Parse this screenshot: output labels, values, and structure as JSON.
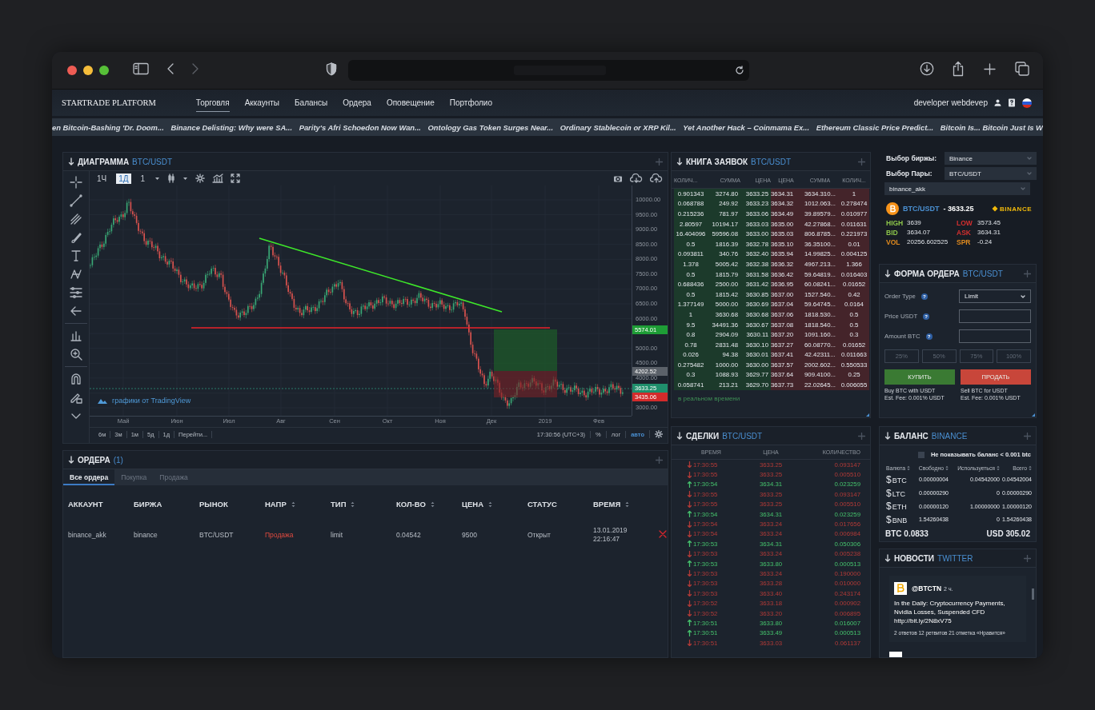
{
  "nav": {
    "brand": "STARTRADE PLATFORM",
    "items": [
      {
        "label": "Торговля",
        "selected": true
      },
      {
        "label": "Аккаунты",
        "selected": false
      },
      {
        "label": "Балансы",
        "selected": false
      },
      {
        "label": "Ордера",
        "selected": false
      },
      {
        "label": "Оповещение",
        "selected": false
      },
      {
        "label": "Портфолио",
        "selected": false
      }
    ],
    "user": "developer webdevep"
  },
  "news_ticker": [
    "en Bitcoin-Bashing 'Dr. Doom...",
    "Binance Delisting: Why were SA...",
    "Parity's Afri Schoedon Now Wan...",
    "Ontology Gas Token Surges Near...",
    "Ordinary Stablecoin or XRP Kil...",
    "Yet Another Hack – Coinmama Ex...",
    "Ethereum Classic Price Predict...",
    "Bitcoin Is... Bitcoin Just Is W"
  ],
  "chart": {
    "title": "ДИАГРАММА",
    "pair": "BTC/USDT",
    "intervals": [
      {
        "label": "1Ч",
        "selected": false
      },
      {
        "label": "1Д",
        "selected": true
      },
      {
        "label": "1",
        "selected": false
      }
    ],
    "price_axis": [
      "10000.00",
      "9500.00",
      "9000.00",
      "8500.00",
      "8000.00",
      "7500.00",
      "7000.00",
      "6500.00",
      "6000.00",
      "5000.00",
      "4500.00",
      "4000.00",
      "3000.00"
    ],
    "time_axis": [
      "Май",
      "Июн",
      "Июл",
      "Авг",
      "Сен",
      "Окт",
      "Ноя",
      "Дек",
      "2019",
      "Фев"
    ],
    "price_tags": [
      {
        "label": "5574.01",
        "color": "#1e9d36"
      },
      {
        "label": "4202.52",
        "color": "#5b6169"
      },
      {
        "label": "3633.25",
        "color": "#1f8f6c"
      },
      {
        "label": "3435.06",
        "color": "#d32b2b"
      }
    ],
    "credit": "графики от TradingView",
    "ranges": [
      "6м",
      "3м",
      "1м",
      "5д",
      "1д",
      "Перейти..."
    ],
    "clock": "17:30:56 (UTC+3)",
    "options": [
      {
        "label": "%",
        "selected": false
      },
      {
        "label": "лог",
        "selected": false
      },
      {
        "label": "авто",
        "selected": true
      }
    ]
  },
  "orders": {
    "title": "ОРДЕРА",
    "count": "(1)",
    "tabs": [
      {
        "label": "Все ордера",
        "selected": true
      },
      {
        "label": "Покупка",
        "selected": false
      },
      {
        "label": "Продажа",
        "selected": false
      }
    ],
    "columns": [
      {
        "label": "АККАУНТ",
        "sortable": false
      },
      {
        "label": "БИРЖА",
        "sortable": false
      },
      {
        "label": "РЫНОК",
        "sortable": false
      },
      {
        "label": "НАПР",
        "sortable": true
      },
      {
        "label": "ТИП",
        "sortable": true
      },
      {
        "label": "КОЛ-ВО",
        "sortable": true
      },
      {
        "label": "ЦЕНА",
        "sortable": true
      },
      {
        "label": "СТАТУС",
        "sortable": false
      },
      {
        "label": "ВРЕМЯ",
        "sortable": true
      }
    ],
    "rows": [
      {
        "kind": "sell",
        "cells": [
          "binance_akk",
          "binance",
          "BTC/USDT",
          "Продажа",
          "limit",
          "0.04542",
          "9500",
          "Открыт",
          "13.01.2019 22:16:47"
        ]
      }
    ]
  },
  "order_book": {
    "title": "КНИГА ЗАЯВОК",
    "pair": "BTC/USDT",
    "columns": [
      "КОЛИЧ...",
      "СУММА",
      "ЦЕНА",
      "ЦЕНА",
      "СУММА",
      "КОЛИЧ..."
    ],
    "rows": [
      [
        "0.901343",
        "3274.80",
        "3633.25",
        "3634.31",
        "3634.310...",
        "1"
      ],
      [
        "0.068788",
        "249.92",
        "3633.23",
        "3634.32",
        "1012.063...",
        "0.278474"
      ],
      [
        "0.215236",
        "781.97",
        "3633.06",
        "3634.49",
        "39.89579...",
        "0.010977"
      ],
      [
        "2.80597",
        "10194.17",
        "3633.03",
        "3635.00",
        "42.27868...",
        "0.011631"
      ],
      [
        "16.404096",
        "59596.08",
        "3633.00",
        "3635.03",
        "806.8785...",
        "0.221973"
      ],
      [
        "0.5",
        "1816.39",
        "3632.78",
        "3635.10",
        "36.35100...",
        "0.01"
      ],
      [
        "0.093811",
        "340.76",
        "3632.40",
        "3635.94",
        "14.99825...",
        "0.004125"
      ],
      [
        "1.378",
        "5005.42",
        "3632.38",
        "3636.32",
        "4967.213...",
        "1.366"
      ],
      [
        "0.5",
        "1815.79",
        "3631.58",
        "3636.42",
        "59.64819...",
        "0.016403"
      ],
      [
        "0.688436",
        "2500.00",
        "3631.42",
        "3636.95",
        "60.08241...",
        "0.01652"
      ],
      [
        "0.5",
        "1815.42",
        "3630.85",
        "3637.00",
        "1527.540...",
        "0.42"
      ],
      [
        "1.377149",
        "5000.00",
        "3630.69",
        "3637.04",
        "59.64745...",
        "0.0164"
      ],
      [
        "1",
        "3630.68",
        "3630.68",
        "3637.06",
        "1818.530...",
        "0.5"
      ],
      [
        "9.5",
        "34491.36",
        "3630.67",
        "3637.08",
        "1818.540...",
        "0.5"
      ],
      [
        "0.8",
        "2904.09",
        "3630.11",
        "3637.20",
        "1091.160...",
        "0.3"
      ],
      [
        "0.78",
        "2831.48",
        "3630.10",
        "3637.27",
        "60.08770...",
        "0.01652"
      ],
      [
        "0.026",
        "94.38",
        "3630.01",
        "3637.41",
        "42.42311...",
        "0.011663"
      ],
      [
        "0.275482",
        "1000.00",
        "3630.00",
        "3637.57",
        "2002.602...",
        "0.550533"
      ],
      [
        "0.3",
        "1088.93",
        "3629.77",
        "3637.64",
        "909.4100...",
        "0.25"
      ],
      [
        "0.058741",
        "213.21",
        "3629.70",
        "3637.73",
        "22.02645...",
        "0.006055"
      ]
    ],
    "footer": "в реальном времени"
  },
  "trades": {
    "title": "СДЕЛКИ",
    "pair": "BTC/USDT",
    "columns": [
      "ВРЕМЯ",
      "ЦЕНА",
      "КОЛИЧЕСТВО"
    ],
    "rows": [
      {
        "kind": "sell",
        "time": "17:30:55",
        "price": "3633.25",
        "amount": "0.093147"
      },
      {
        "kind": "sell",
        "time": "17:30:55",
        "price": "3633.25",
        "amount": "0.005510"
      },
      {
        "kind": "buy",
        "time": "17:30:54",
        "price": "3634.31",
        "amount": "0.023259"
      },
      {
        "kind": "sell",
        "time": "17:30:55",
        "price": "3633.25",
        "amount": "0.093147"
      },
      {
        "kind": "sell",
        "time": "17:30:55",
        "price": "3633.25",
        "amount": "0.005510"
      },
      {
        "kind": "buy",
        "time": "17:30:54",
        "price": "3634.31",
        "amount": "0.023259"
      },
      {
        "kind": "sell",
        "time": "17:30:54",
        "price": "3633.24",
        "amount": "0.017656"
      },
      {
        "kind": "sell",
        "time": "17:30:54",
        "price": "3633.24",
        "amount": "0.006984"
      },
      {
        "kind": "buy",
        "time": "17:30:53",
        "price": "3634.31",
        "amount": "0.050306"
      },
      {
        "kind": "sell",
        "time": "17:30:53",
        "price": "3633.24",
        "amount": "0.005238"
      },
      {
        "kind": "buy",
        "time": "17:30:53",
        "price": "3633.80",
        "amount": "0.000513"
      },
      {
        "kind": "sell",
        "time": "17:30:53",
        "price": "3633.24",
        "amount": "0.190000"
      },
      {
        "kind": "sell",
        "time": "17:30:53",
        "price": "3633.28",
        "amount": "0.010000"
      },
      {
        "kind": "sell",
        "time": "17:30:53",
        "price": "3633.40",
        "amount": "0.243174"
      },
      {
        "kind": "sell",
        "time": "17:30:52",
        "price": "3633.18",
        "amount": "0.000902"
      },
      {
        "kind": "sell",
        "time": "17:30:52",
        "price": "3633.20",
        "amount": "0.006895"
      },
      {
        "kind": "buy",
        "time": "17:30:51",
        "price": "3633.80",
        "amount": "0.016007"
      },
      {
        "kind": "buy",
        "time": "17:30:51",
        "price": "3633.49",
        "amount": "0.000513"
      },
      {
        "kind": "sell",
        "time": "17:30:51",
        "price": "3633.03",
        "amount": "0.061137"
      }
    ]
  },
  "market": {
    "exchange_label": "Выбор биржы:",
    "exchange": "Binance",
    "pair_label": "Выбор Пары:",
    "pair": "BTC/USDT",
    "account": "binance_akk",
    "symbol": "BTC/USDT",
    "price": "- 3633.25",
    "exchange_logo": "BINANCE",
    "stats": [
      {
        "label": "HIGH",
        "value": "3639",
        "color": "#8bc34a"
      },
      {
        "label": "LOW",
        "value": "3573.45",
        "color": "#d32f2f"
      },
      {
        "label": "BID",
        "value": "3634.07",
        "color": "#8bc34a"
      },
      {
        "label": "ASK",
        "value": "3634.31",
        "color": "#d32f2f"
      },
      {
        "label": "VOL",
        "value": "20256.602525",
        "color": "#e08a1e"
      },
      {
        "label": "SPR",
        "value": "-0.24",
        "color": "#e08a1e"
      }
    ]
  },
  "order_form": {
    "title": "ФОРМА ОРДЕРА",
    "pair": "BTC/USDT",
    "fields": [
      {
        "kind": "select",
        "label": "Order Type",
        "help": "?",
        "value": "Limit"
      },
      {
        "kind": "input",
        "label": "Price USDT",
        "help": "?"
      },
      {
        "kind": "input",
        "label": "Amount BTC",
        "help": "?"
      }
    ],
    "percent_buttons": [
      "25%",
      "50%",
      "75%",
      "100%"
    ],
    "buy": {
      "label": "КУПИТЬ",
      "notes": [
        "Buy BTC with USDT",
        "Est. Fee: 0.001% USDT"
      ]
    },
    "sell": {
      "label": "ПРОДАТЬ",
      "notes": [
        "Sell BTC for USDT",
        "Est. Fee: 0.001% USDT"
      ]
    }
  },
  "balance": {
    "title": "БАЛАНС",
    "exchange": "BINANCE",
    "hide_small": {
      "label": "Не показывать баланс < 0.001 btc",
      "checked": false
    },
    "columns": [
      "Валюта",
      "Свободно",
      "Используеться",
      "Всего"
    ],
    "rows": [
      {
        "sign": "$",
        "coin": "BTC",
        "free": "0.00000004",
        "used": "0.04542000",
        "total": "0.04542004"
      },
      {
        "sign": "$",
        "coin": "LTC",
        "free": "0.00000290",
        "used": "0",
        "total": "0.00000290"
      },
      {
        "sign": "$",
        "coin": "ETH",
        "free": "0.00000120",
        "used": "1.00000000",
        "total": "1.00000120"
      },
      {
        "sign": "$",
        "coin": "BNB",
        "free": "1.54260438",
        "used": "0",
        "total": "1.54260438"
      }
    ],
    "total_btc": "BTC 0.0833",
    "total_usd": "USD 305.02"
  },
  "news": {
    "title": "НОВОСТИ",
    "source": "TWITTER",
    "items": [
      {
        "author": "@BTCTN",
        "age": "2 ч.",
        "text": "In the Daily: Cryptocurrency Payments, Nvidia Losses, Suspended CFD",
        "link": "http://bit.ly/2N8xV75",
        "stats": "2 ответов 12 ретвитов 21 отметка «Нравится»"
      }
    ]
  }
}
